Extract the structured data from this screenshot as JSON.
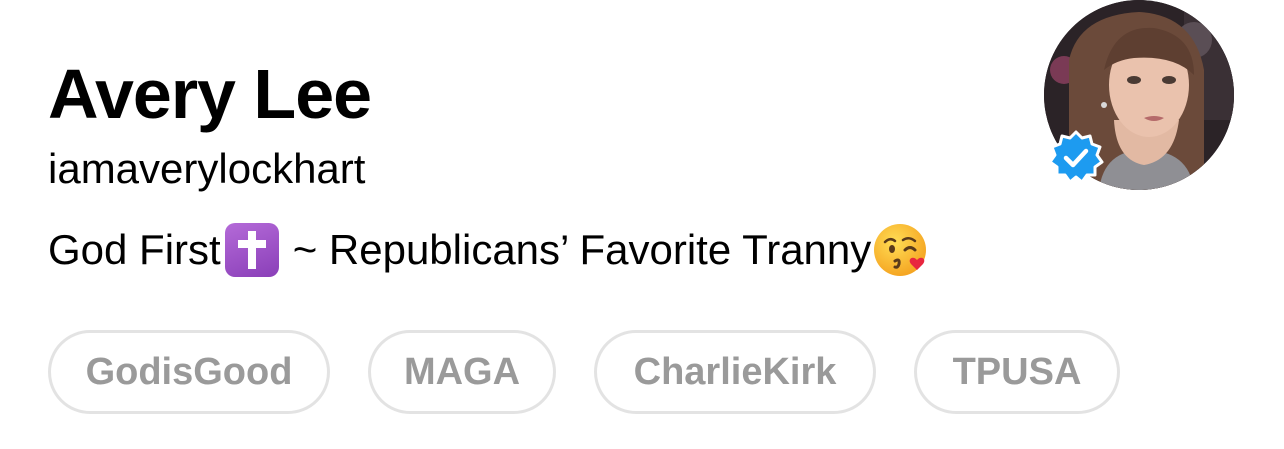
{
  "profile": {
    "display_name": "Avery Lee",
    "username": "iamaverylockhart",
    "bio": {
      "part1": "God First",
      "part2": " ~ Republicans’ Favorite Tranny",
      "emoji1": "latin-cross-emoji",
      "emoji2": "face-blowing-kiss-emoji"
    },
    "verified": true
  },
  "tags": [
    {
      "label": "GodisGood"
    },
    {
      "label": "MAGA"
    },
    {
      "label": "CharlieKirk"
    },
    {
      "label": "TPUSA"
    }
  ],
  "colors": {
    "verified_badge": "#1d9bf0",
    "tag_text": "#9a9a9a",
    "tag_border": "#e3e3e3",
    "cross_emoji_bg": "#9b4fc8"
  }
}
